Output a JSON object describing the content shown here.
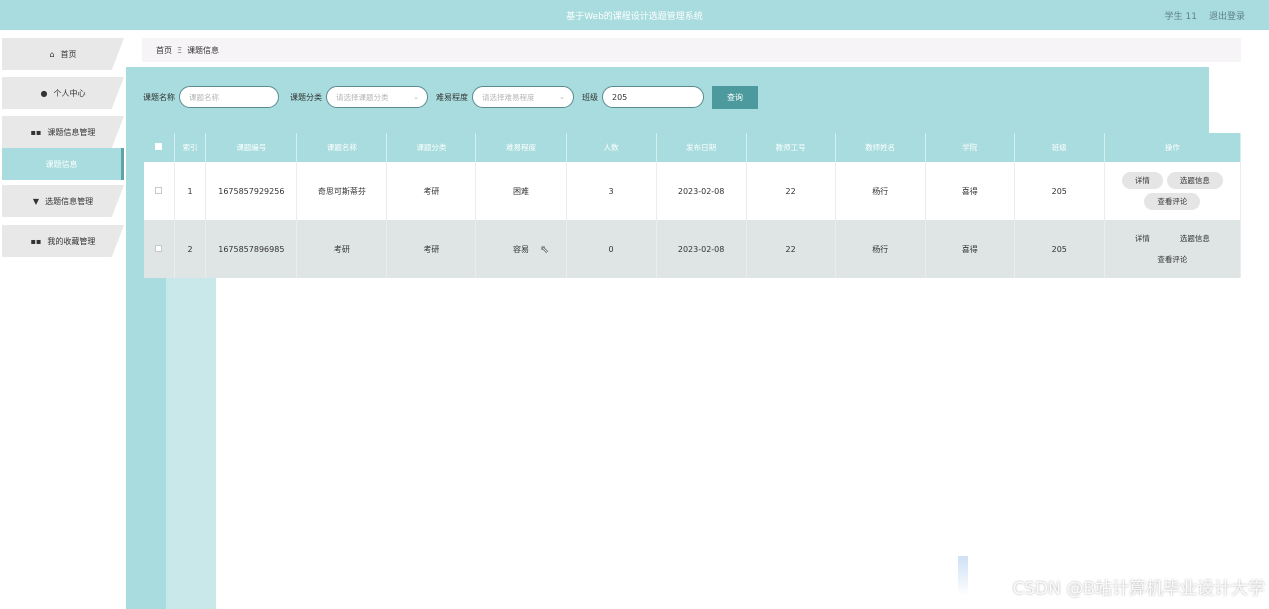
{
  "header": {
    "title": "基于Web的课程设计选题管理系统",
    "user": "学生 11",
    "logout": "退出登录"
  },
  "sidebar": {
    "items": [
      {
        "label": "首页"
      },
      {
        "label": "个人中心"
      },
      {
        "label": "课题信息管理"
      },
      {
        "label": "课题信息"
      },
      {
        "label": "选题信息管理"
      },
      {
        "label": "我的收藏管理"
      }
    ]
  },
  "breadcrumb": {
    "home": "首页",
    "current": "课题信息"
  },
  "search": {
    "name_label": "课题名称",
    "name_placeholder": "课题名称",
    "category_label": "课题分类",
    "category_placeholder": "请选择课题分类",
    "difficulty_label": "难易程度",
    "difficulty_placeholder": "请选择难易程度",
    "class_label": "班级",
    "class_value": "205",
    "query_button": "查询"
  },
  "table": {
    "headers": [
      "索引",
      "课题编号",
      "课题名称",
      "课题分类",
      "难易程度",
      "人数",
      "发布日期",
      "教师工号",
      "教师姓名",
      "学院",
      "班级",
      "操作"
    ],
    "rows": [
      {
        "index": "1",
        "code": "1675857929256",
        "name": "奇思可斯蒂芬",
        "category": "考研",
        "difficulty": "困难",
        "count": "3",
        "date": "2023-02-08",
        "teacher_id": "22",
        "teacher_name": "杨行",
        "college": "喜得",
        "class": "205"
      },
      {
        "index": "2",
        "code": "1675857896985",
        "name": "考研",
        "category": "考研",
        "difficulty": "容易",
        "count": "0",
        "date": "2023-02-08",
        "teacher_id": "22",
        "teacher_name": "杨行",
        "college": "喜得",
        "class": "205"
      }
    ],
    "actions": {
      "detail": "详情",
      "select": "选题信息",
      "comment": "查看评论"
    }
  },
  "watermark": "CSDN @B站计算机毕业设计大学"
}
